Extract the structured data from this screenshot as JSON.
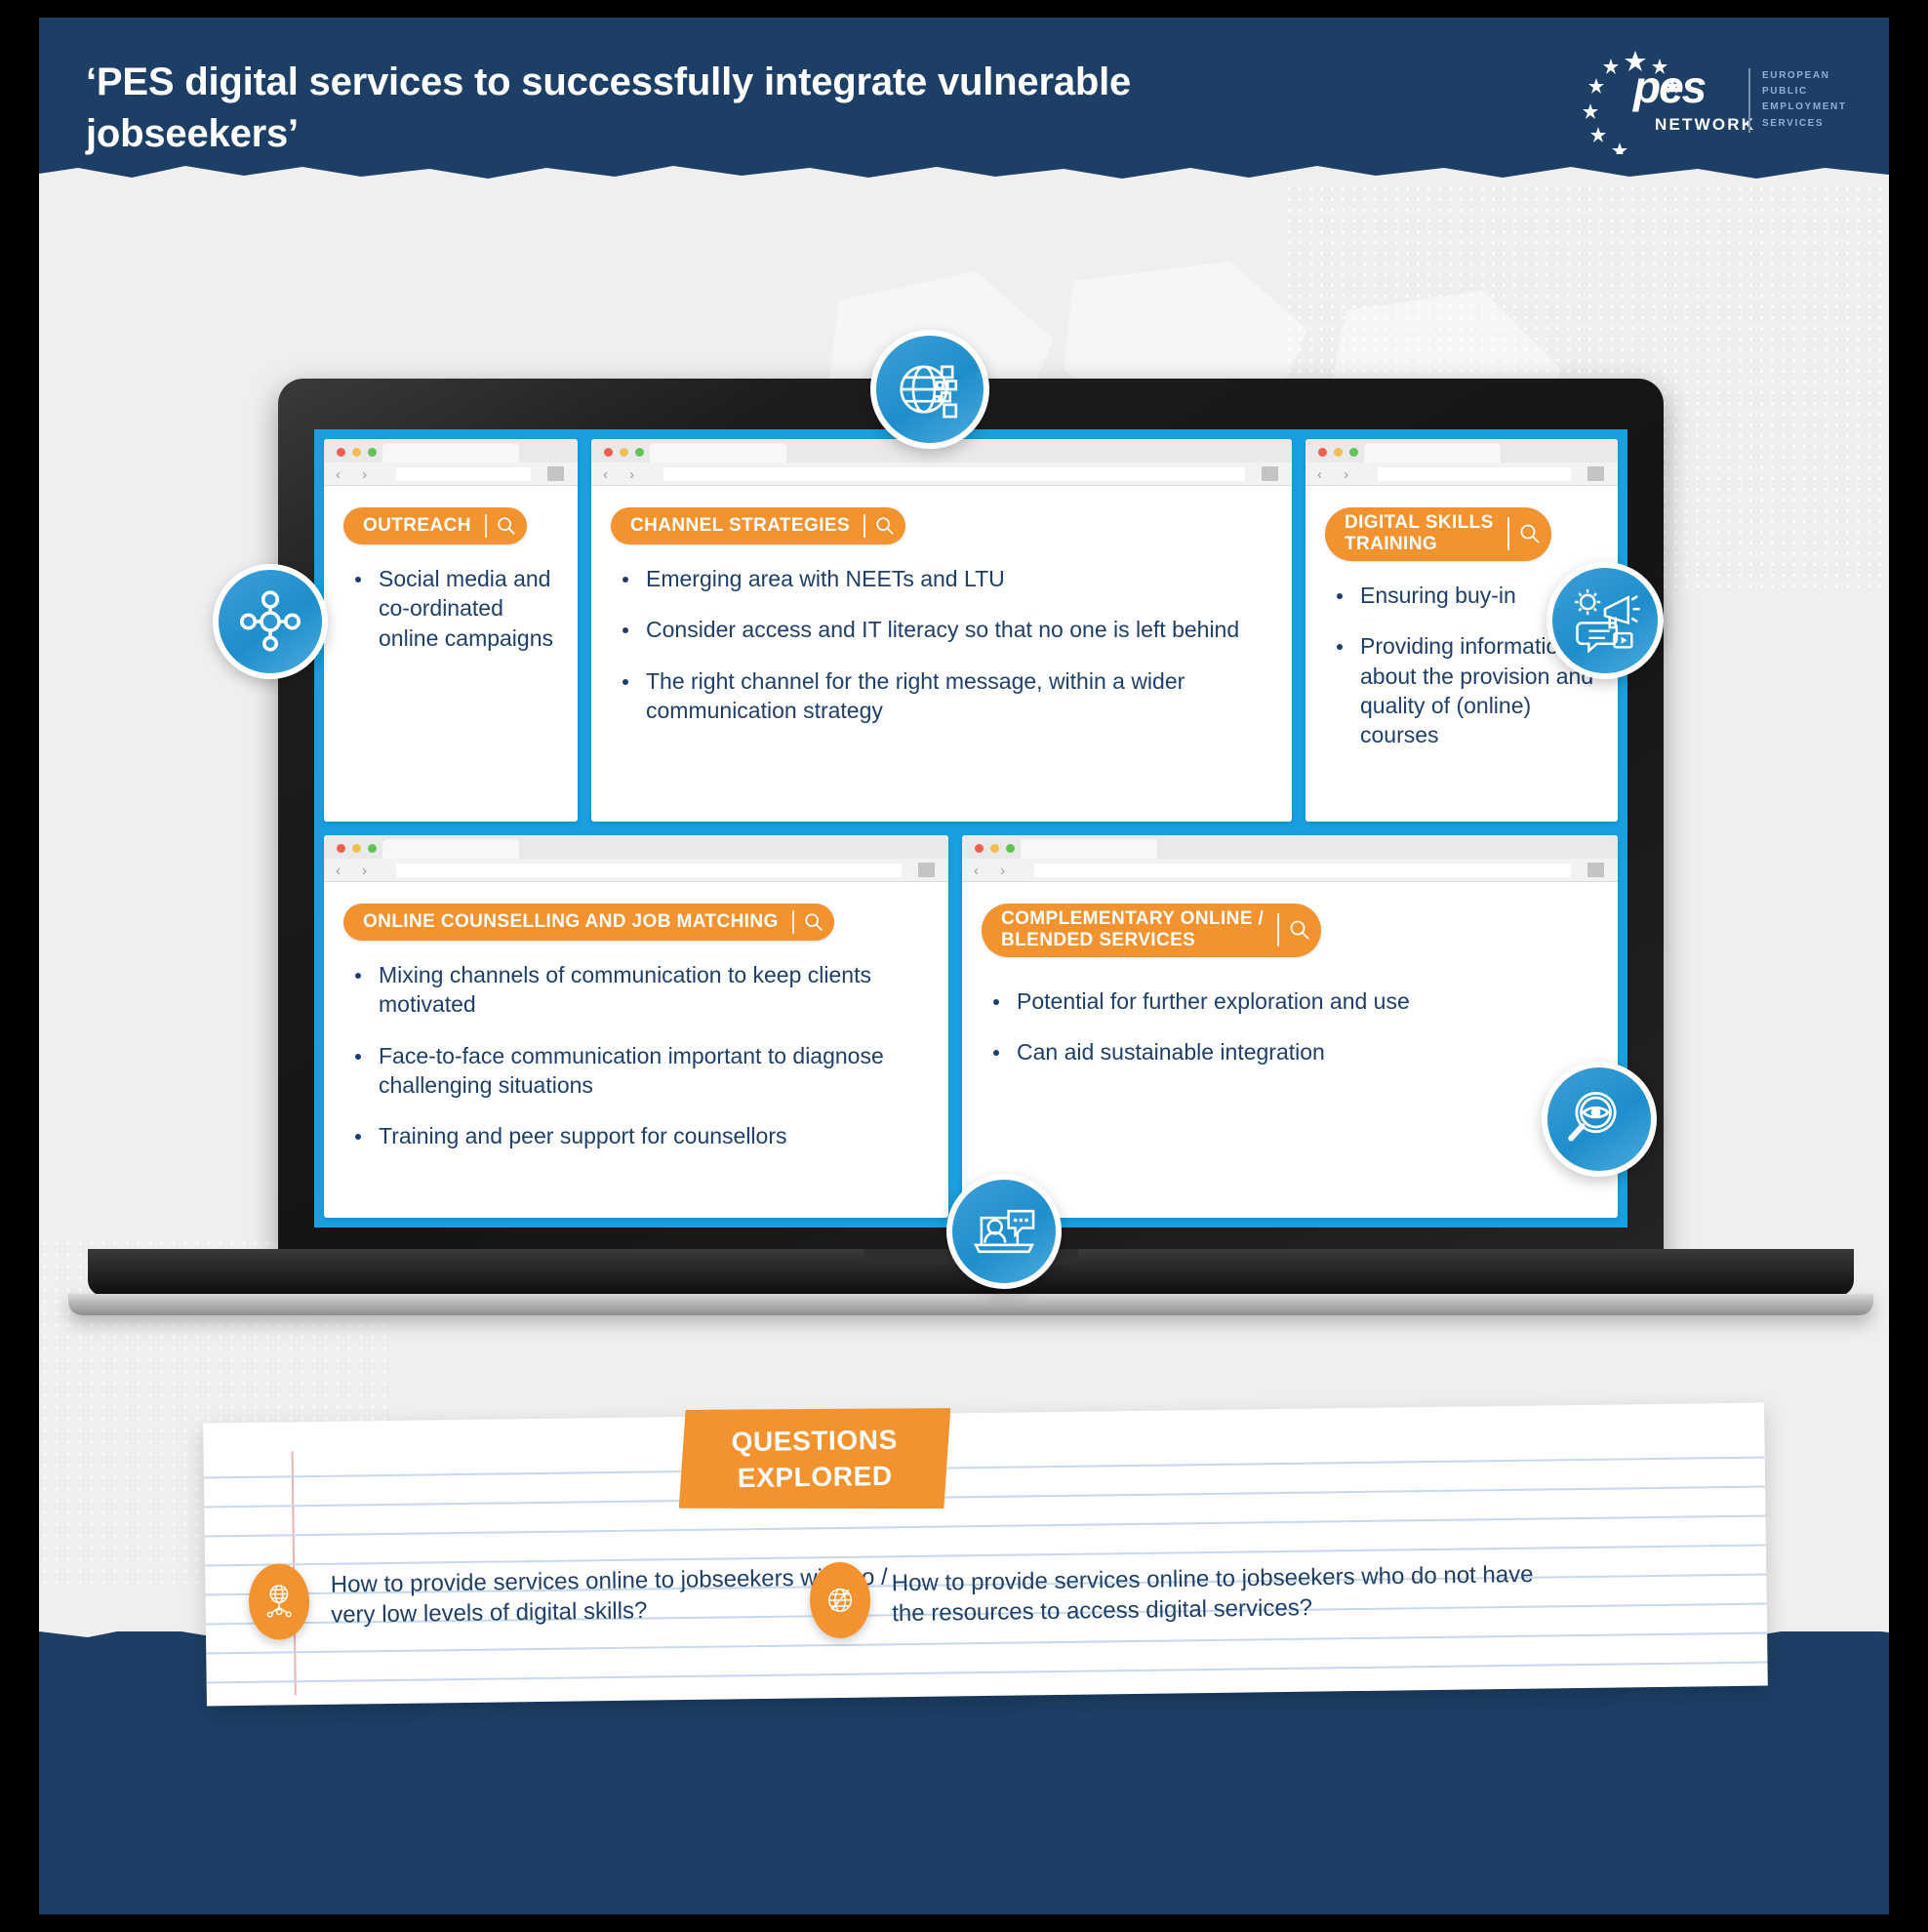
{
  "header": {
    "title": "‘PES digital services to successfully integrate vulnerable jobseekers’",
    "logo": {
      "wordmark": "pes",
      "network": "NETWORK",
      "subtitle": "EUROPEAN\nPUBLIC\nEMPLOYMENT\nSERVICES"
    }
  },
  "colors": {
    "navy": "#1d3f66",
    "orange": "#f29330",
    "blue": "#1aa0e0",
    "badge_blue": "#2e96d2",
    "text_navy": "#1f3f69",
    "paper": "#f0eeee"
  },
  "cards": [
    {
      "id": "outreach",
      "title": "OUTREACH",
      "bullets": [
        "Social media and co-ordinated online campaigns"
      ]
    },
    {
      "id": "channel-strategies",
      "title": "CHANNEL STRATEGIES",
      "bullets": [
        "Emerging area with NEETs and LTU",
        "Consider access and IT literacy so that no one is left behind",
        "The right channel for the right message, within a wider communication strategy"
      ]
    },
    {
      "id": "digital-skills-training",
      "title": "DIGITAL SKILLS\nTRAINING",
      "bullets": [
        "Ensuring buy-in",
        "Providing information about the provision and quality of (online) courses"
      ]
    },
    {
      "id": "online-counselling-and-job-matching",
      "title": "ONLINE COUNSELLING AND JOB MATCHING",
      "bullets": [
        "Mixing channels of communication to keep clients motivated",
        "Face-to-face communication important to diagnose challenging situations",
        "Training and peer support for counsellors"
      ]
    },
    {
      "id": "complementary-online-blended-services",
      "title": "COMPLEMENTARY ONLINE /\nBLENDED SERVICES",
      "bullets": [
        "Potential for further exploration and use",
        "Can aid sustainable integration"
      ]
    }
  ],
  "badges": [
    {
      "name": "network-nodes-icon"
    },
    {
      "name": "globe-digital-icon"
    },
    {
      "name": "megaphone-communication-icon"
    },
    {
      "name": "video-counselling-icon"
    },
    {
      "name": "magnifier-eye-icon"
    }
  ],
  "questions": {
    "tape_label": "QUESTIONS\nEXPLORED",
    "items": [
      {
        "icon": "globe-network-icon",
        "text": "How to provide services online to jobseekers with no / very low levels of digital skills?"
      },
      {
        "icon": "globe-blocked-icon",
        "text": "How to provide services online to jobseekers who do not have the resources to access digital services?"
      }
    ]
  },
  "browser_chrome": {
    "back_forward": "‹  ›",
    "dots": [
      "close-dot",
      "minimize-dot",
      "maximize-dot"
    ]
  }
}
